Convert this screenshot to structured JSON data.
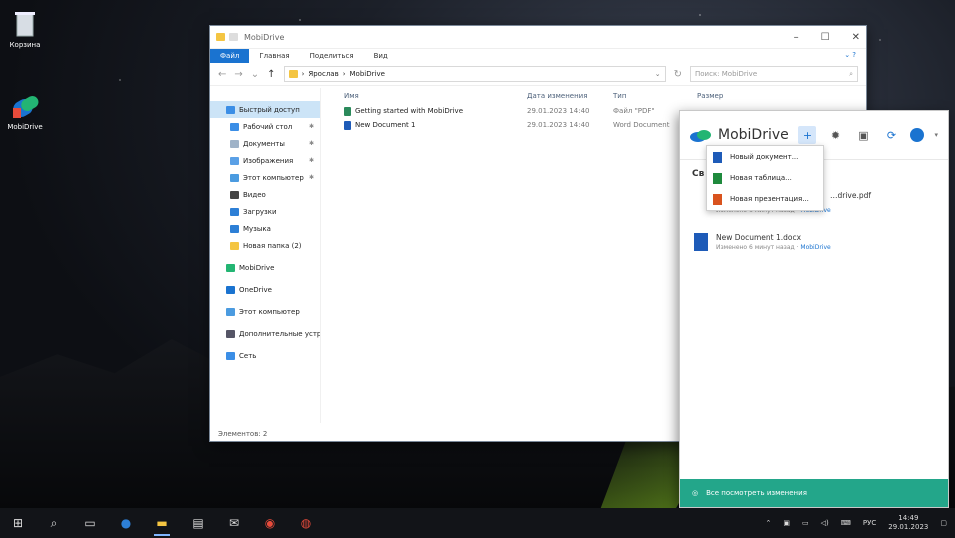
{
  "desktop": {
    "icons": [
      {
        "label": "Корзина"
      },
      {
        "label": "MobiDrive"
      }
    ]
  },
  "explorer": {
    "title": "MobiDrive",
    "ribbon_tabs": [
      "Файл",
      "Главная",
      "Поделиться",
      "Вид"
    ],
    "address": [
      "Ярослав",
      "MobiDrive"
    ],
    "search_placeholder": "Поиск: MobiDrive",
    "sidebar": [
      {
        "label": "Быстрый доступ",
        "group": true,
        "active": true
      },
      {
        "label": "Рабочий стол",
        "pinned": true
      },
      {
        "label": "Документы",
        "pinned": true
      },
      {
        "label": "Изображения",
        "pinned": true
      },
      {
        "label": "Этот компьютер",
        "pinned": true
      },
      {
        "label": "Видео"
      },
      {
        "label": "Загрузки"
      },
      {
        "label": "Музыка"
      },
      {
        "label": "Новая папка (2)"
      },
      {
        "label": "MobiDrive",
        "group": true
      },
      {
        "label": "OneDrive",
        "group": true
      },
      {
        "label": "Этот компьютер",
        "group": true
      },
      {
        "label": "Дополнительные устр",
        "group": true
      },
      {
        "label": "Сеть",
        "group": true
      }
    ],
    "columns": [
      "Имя",
      "Дата изменения",
      "Тип",
      "Размер"
    ],
    "files": [
      {
        "name": "Getting started with MobiDrive",
        "date": "29.01.2023 14:40",
        "type": "Файл \"PDF\""
      },
      {
        "name": "New Document 1",
        "date": "29.01.2023 14:40",
        "type": "Word Document"
      }
    ],
    "status": "Элементов: 2"
  },
  "mobidrive": {
    "brand": "MobiDrive",
    "section": "Св",
    "files": [
      {
        "name": "…drive.pdf",
        "meta": "Изменено 6 минут назад",
        "link": "MobiDrive"
      },
      {
        "name": "New Document 1.docx",
        "meta": "Изменено 6 минут назад",
        "link": "MobiDrive"
      }
    ],
    "footer": "Все посмотреть изменения",
    "menu": [
      {
        "label": "Новый документ...",
        "color": "#1e5bb8"
      },
      {
        "label": "Новая таблица...",
        "color": "#1f8a3d"
      },
      {
        "label": "Новая презентация...",
        "color": "#d9531e"
      }
    ]
  },
  "taskbar": {
    "lang": "РУС",
    "time": "14:49",
    "date": "29.01.2023"
  }
}
